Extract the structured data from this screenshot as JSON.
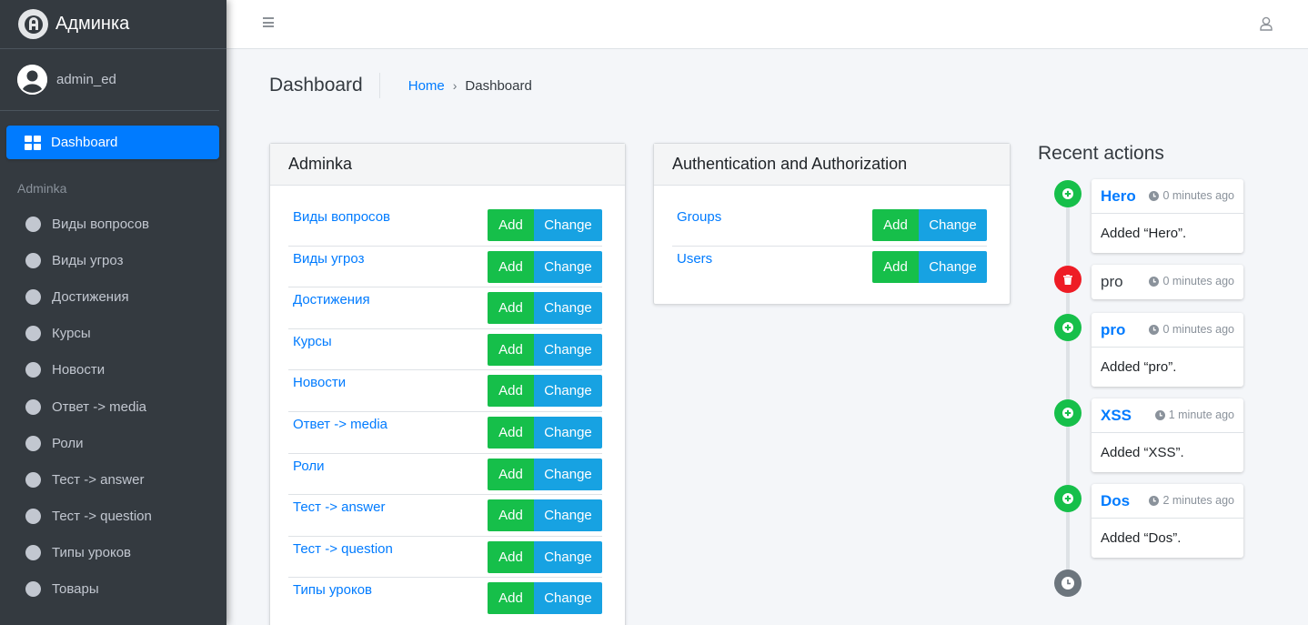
{
  "brand": {
    "name": "Админка",
    "logo_icon": "adminlte-logo-icon"
  },
  "user": {
    "name": "admin_ed"
  },
  "sidebar": {
    "active_item": {
      "label": "Dashboard",
      "icon": "dashboard-grid-icon"
    },
    "section_header": "Adminka",
    "items": [
      {
        "label": "Виды вопросов"
      },
      {
        "label": "Виды угроз"
      },
      {
        "label": "Достижения"
      },
      {
        "label": "Курсы"
      },
      {
        "label": "Новости"
      },
      {
        "label": "Ответ -> media"
      },
      {
        "label": "Роли"
      },
      {
        "label": "Тест -> answer"
      },
      {
        "label": "Тест -> question"
      },
      {
        "label": "Типы уроков"
      },
      {
        "label": "Товары"
      }
    ]
  },
  "header": {
    "menu_icon": "hamburger-icon",
    "user_icon": "user-outline-icon"
  },
  "page": {
    "title": "Dashboard",
    "breadcrumb": {
      "home": "Home",
      "separator": "›",
      "current": "Dashboard"
    }
  },
  "apps": [
    {
      "title": "Adminka",
      "models": [
        {
          "name": "Виды вопросов",
          "add": "Add",
          "change": "Change"
        },
        {
          "name": "Виды угроз",
          "add": "Add",
          "change": "Change"
        },
        {
          "name": "Достижения",
          "add": "Add",
          "change": "Change"
        },
        {
          "name": "Курсы",
          "add": "Add",
          "change": "Change"
        },
        {
          "name": "Новости",
          "add": "Add",
          "change": "Change"
        },
        {
          "name": "Ответ -> media",
          "add": "Add",
          "change": "Change"
        },
        {
          "name": "Роли",
          "add": "Add",
          "change": "Change"
        },
        {
          "name": "Тест -> answer",
          "add": "Add",
          "change": "Change"
        },
        {
          "name": "Тест -> question",
          "add": "Add",
          "change": "Change"
        },
        {
          "name": "Типы уроков",
          "add": "Add",
          "change": "Change"
        }
      ]
    },
    {
      "title": "Authentication and Authorization",
      "models": [
        {
          "name": "Groups",
          "add": "Add",
          "change": "Change"
        },
        {
          "name": "Users",
          "add": "Add",
          "change": "Change"
        }
      ]
    }
  ],
  "recent_actions": {
    "title": "Recent actions",
    "items": [
      {
        "type": "add",
        "name": "Hero",
        "time": "0 minutes ago",
        "desc": "Added “Hero”."
      },
      {
        "type": "delete",
        "name": "pro",
        "time": "0 minutes ago",
        "desc": ""
      },
      {
        "type": "add",
        "name": "pro",
        "time": "0 minutes ago",
        "desc": "Added “pro”."
      },
      {
        "type": "add",
        "name": "XSS",
        "time": "1 minute ago",
        "desc": "Added “XSS”."
      },
      {
        "type": "add",
        "name": "Dos",
        "time": "2 minutes ago",
        "desc": "Added “Dos”."
      }
    ]
  },
  "colors": {
    "sidebar_bg": "#343a40",
    "primary": "#007bff",
    "success": "#16bf4a",
    "info": "#17a2e2",
    "danger": "#ee1c25"
  }
}
